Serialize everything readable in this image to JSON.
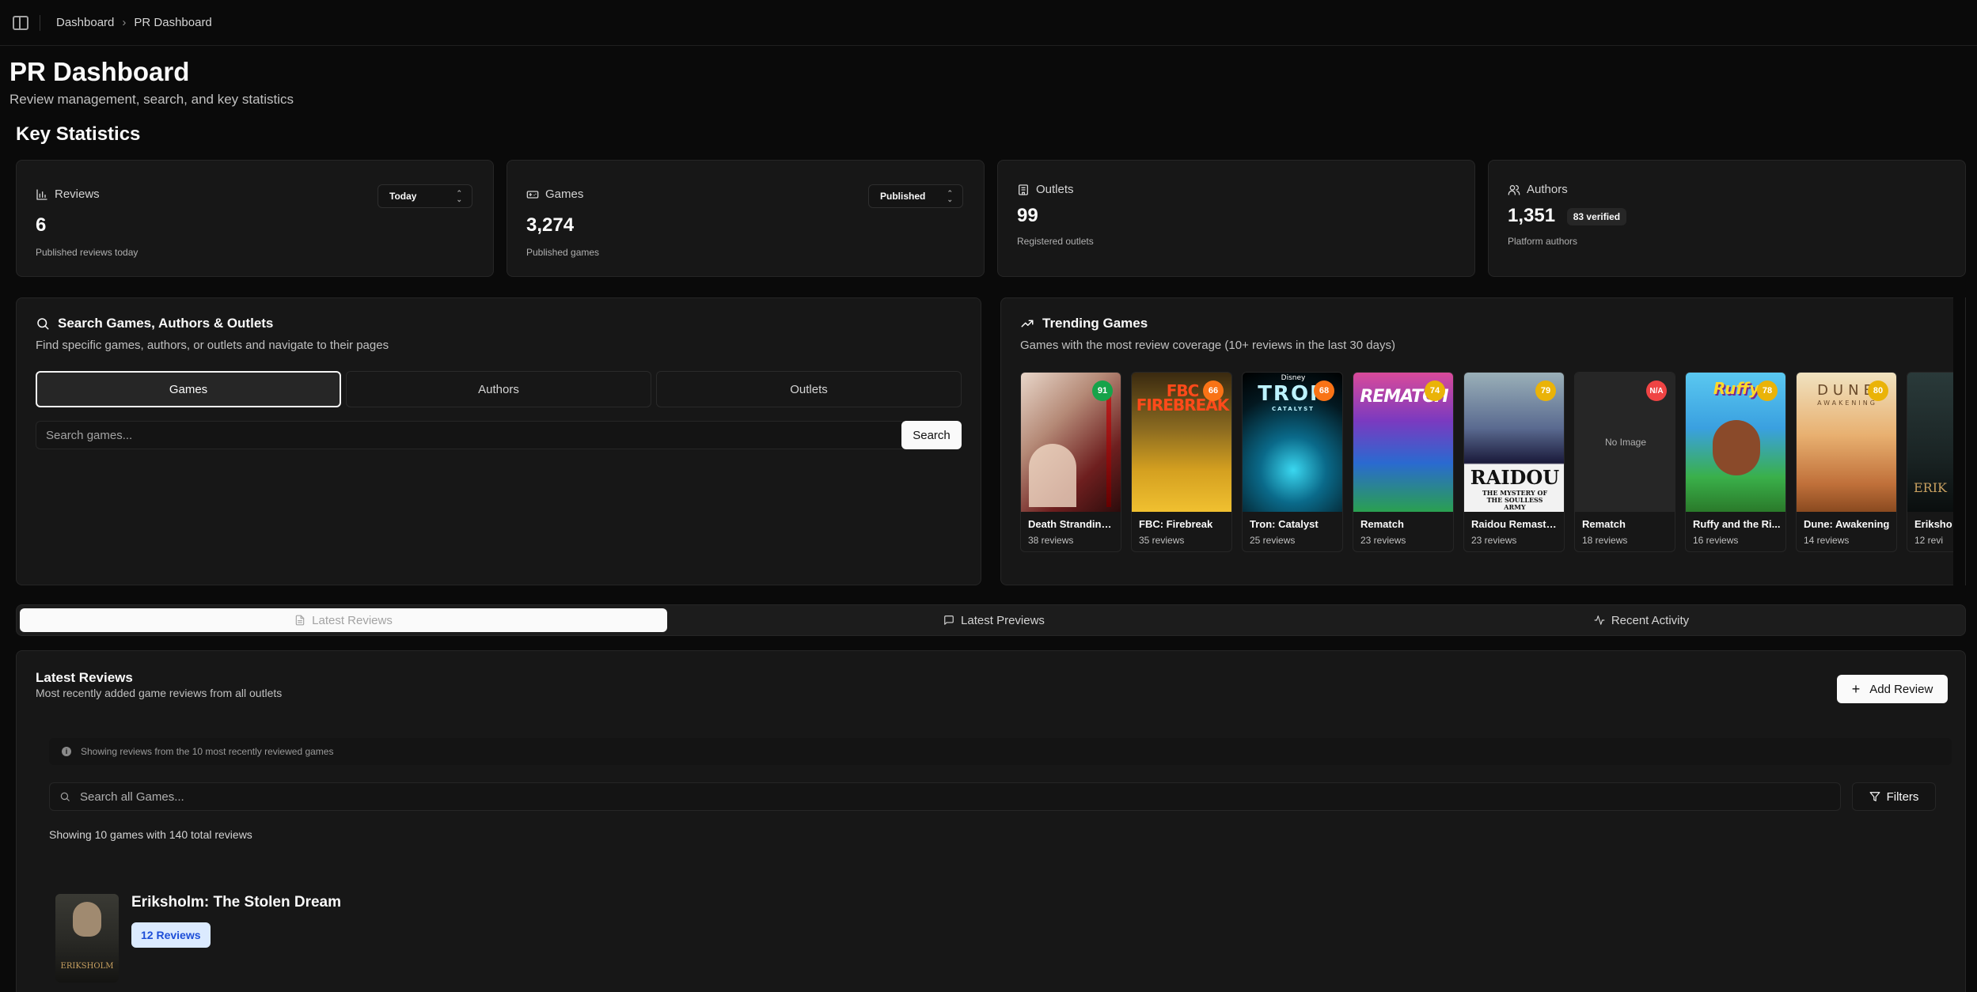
{
  "breadcrumb": {
    "items": [
      "Dashboard",
      "PR Dashboard"
    ]
  },
  "header": {
    "title": "PR Dashboard",
    "subtitle": "Review management, search, and key statistics"
  },
  "stats": {
    "section_title": "Key Statistics",
    "reviews": {
      "label": "Reviews",
      "value": "6",
      "desc": "Published reviews today",
      "select": "Today"
    },
    "games": {
      "label": "Games",
      "value": "3,274",
      "desc": "Published games",
      "select": "Published"
    },
    "outlets": {
      "label": "Outlets",
      "value": "99",
      "desc": "Registered outlets"
    },
    "authors": {
      "label": "Authors",
      "value": "1,351",
      "badge": "83 verified",
      "desc": "Platform authors"
    }
  },
  "search": {
    "title": "Search Games, Authors & Outlets",
    "subtitle": "Find specific games, authors, or outlets and navigate to their pages",
    "tabs": [
      "Games",
      "Authors",
      "Outlets"
    ],
    "placeholder": "Search games...",
    "button": "Search"
  },
  "trending": {
    "title": "Trending Games",
    "subtitle": "Games with the most review coverage (10+ reviews in the last 30 days)",
    "no_image": "No Image",
    "games": [
      {
        "name": "Death Stranding ...",
        "reviews": "38 reviews",
        "score": "91",
        "score_color": "#16a34a"
      },
      {
        "name": "FBC: Firebreak",
        "reviews": "35 reviews",
        "score": "66",
        "score_color": "#f97316"
      },
      {
        "name": "Tron: Catalyst",
        "reviews": "25 reviews",
        "score": "68",
        "score_color": "#f97316"
      },
      {
        "name": "Rematch",
        "reviews": "23 reviews",
        "score": "74",
        "score_color": "#eab308"
      },
      {
        "name": "Raidou Remaste...",
        "reviews": "23 reviews",
        "score": "79",
        "score_color": "#eab308"
      },
      {
        "name": "Rematch",
        "reviews": "18 reviews",
        "score": "N/A",
        "score_color": "#ef4444"
      },
      {
        "name": "Ruffy and the Ri...",
        "reviews": "16 reviews",
        "score": "78",
        "score_color": "#eab308"
      },
      {
        "name": "Dune: Awakening",
        "reviews": "14 reviews",
        "score": "80",
        "score_color": "#eab308"
      },
      {
        "name": "Eriksho",
        "reviews": "12 revi",
        "score": "",
        "score_color": "#eab308"
      }
    ],
    "covers": {
      "fbc": "FBC FIREBREAK",
      "tron": "TRON",
      "tron_small": "CATALYST",
      "tron_brand": "Disney",
      "rematch": "REMATCH",
      "raidou": "RAIDOU",
      "raidou_sub": "THE MYSTERY OF THE SOULLESS ARMY",
      "ruffy": "Ruffy",
      "dune": "DUNE",
      "dune_sub": "AWAKENING",
      "erik": "ERIK"
    }
  },
  "tabs": [
    "Latest Reviews",
    "Latest Previews",
    "Recent Activity"
  ],
  "latest": {
    "title": "Latest Reviews",
    "subtitle": "Most recently added game reviews from all outlets",
    "add_button": "Add Review",
    "info": "Showing reviews from the 10 most recently reviewed games",
    "search_placeholder": "Search all Games...",
    "filters": "Filters",
    "summary": "Showing 10 games with 140 total reviews",
    "item": {
      "title": "Eriksholm: The Stolen Dream",
      "badge": "12 Reviews",
      "cover_text": "ERIKSHOLM"
    }
  }
}
